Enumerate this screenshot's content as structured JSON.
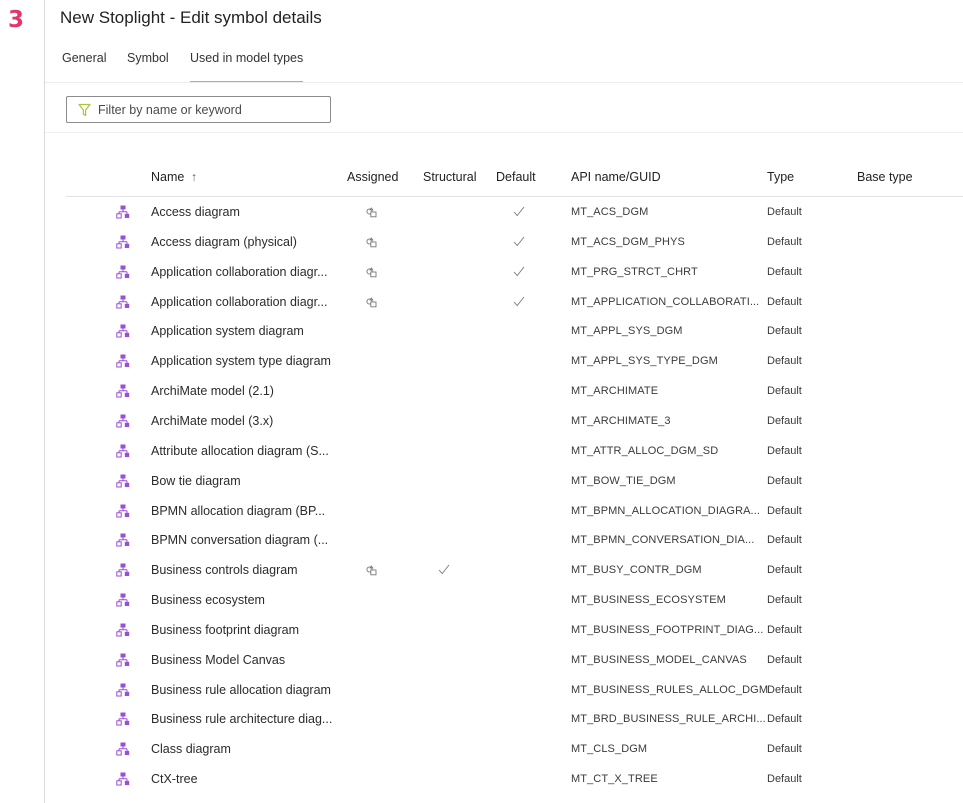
{
  "step_number": "3",
  "title": "New Stoplight - Edit symbol details",
  "tabs": [
    {
      "label": "General",
      "active": false
    },
    {
      "label": "Symbol",
      "active": false
    },
    {
      "label": "Used in model types",
      "active": true
    }
  ],
  "filter": {
    "placeholder": "Filter by name or keyword",
    "value": "",
    "icon": "filter-funnel-icon"
  },
  "accent_color": "#a9c43f",
  "step_color": "#e2356b",
  "model_icon_color": "#9b4fd6",
  "table": {
    "columns": {
      "name": "Name",
      "name_sort": "↑",
      "assigned": "Assigned",
      "structural": "Structural",
      "default": "Default",
      "api": "API name/GUID",
      "type": "Type",
      "base_type": "Base type"
    },
    "rows": [
      {
        "name": "Access diagram",
        "assigned": true,
        "structural": false,
        "default": true,
        "api": "MT_ACS_DGM",
        "type": "Default",
        "base_type": ""
      },
      {
        "name": "Access diagram (physical)",
        "assigned": true,
        "structural": false,
        "default": true,
        "api": "MT_ACS_DGM_PHYS",
        "type": "Default",
        "base_type": ""
      },
      {
        "name": "Application collaboration diagr...",
        "assigned": true,
        "structural": false,
        "default": true,
        "api": "MT_PRG_STRCT_CHRT",
        "type": "Default",
        "base_type": ""
      },
      {
        "name": "Application collaboration diagr...",
        "assigned": true,
        "structural": false,
        "default": true,
        "api": "MT_APPLICATION_COLLABORATI...",
        "type": "Default",
        "base_type": ""
      },
      {
        "name": "Application system diagram",
        "assigned": false,
        "structural": false,
        "default": false,
        "api": "MT_APPL_SYS_DGM",
        "type": "Default",
        "base_type": ""
      },
      {
        "name": "Application system type diagram",
        "assigned": false,
        "structural": false,
        "default": false,
        "api": "MT_APPL_SYS_TYPE_DGM",
        "type": "Default",
        "base_type": ""
      },
      {
        "name": "ArchiMate model (2.1)",
        "assigned": false,
        "structural": false,
        "default": false,
        "api": "MT_ARCHIMATE",
        "type": "Default",
        "base_type": ""
      },
      {
        "name": "ArchiMate model (3.x)",
        "assigned": false,
        "structural": false,
        "default": false,
        "api": "MT_ARCHIMATE_3",
        "type": "Default",
        "base_type": ""
      },
      {
        "name": "Attribute allocation diagram (S...",
        "assigned": false,
        "structural": false,
        "default": false,
        "api": "MT_ATTR_ALLOC_DGM_SD",
        "type": "Default",
        "base_type": ""
      },
      {
        "name": "Bow tie diagram",
        "assigned": false,
        "structural": false,
        "default": false,
        "api": "MT_BOW_TIE_DGM",
        "type": "Default",
        "base_type": ""
      },
      {
        "name": "BPMN allocation diagram (BP...",
        "assigned": false,
        "structural": false,
        "default": false,
        "api": "MT_BPMN_ALLOCATION_DIAGRA...",
        "type": "Default",
        "base_type": ""
      },
      {
        "name": "BPMN conversation diagram (...",
        "assigned": false,
        "structural": false,
        "default": false,
        "api": "MT_BPMN_CONVERSATION_DIA...",
        "type": "Default",
        "base_type": ""
      },
      {
        "name": "Business controls diagram",
        "assigned": true,
        "structural": true,
        "default": false,
        "api": "MT_BUSY_CONTR_DGM",
        "type": "Default",
        "base_type": ""
      },
      {
        "name": "Business ecosystem",
        "assigned": false,
        "structural": false,
        "default": false,
        "api": "MT_BUSINESS_ECOSYSTEM",
        "type": "Default",
        "base_type": ""
      },
      {
        "name": "Business footprint diagram",
        "assigned": false,
        "structural": false,
        "default": false,
        "api": "MT_BUSINESS_FOOTPRINT_DIAG...",
        "type": "Default",
        "base_type": ""
      },
      {
        "name": "Business Model Canvas",
        "assigned": false,
        "structural": false,
        "default": false,
        "api": "MT_BUSINESS_MODEL_CANVAS",
        "type": "Default",
        "base_type": ""
      },
      {
        "name": "Business rule allocation diagram",
        "assigned": false,
        "structural": false,
        "default": false,
        "api": "MT_BUSINESS_RULES_ALLOC_DGM",
        "type": "Default",
        "base_type": ""
      },
      {
        "name": "Business rule architecture diag...",
        "assigned": false,
        "structural": false,
        "default": false,
        "api": "MT_BRD_BUSINESS_RULE_ARCHI...",
        "type": "Default",
        "base_type": ""
      },
      {
        "name": "Class diagram",
        "assigned": false,
        "structural": false,
        "default": false,
        "api": "MT_CLS_DGM",
        "type": "Default",
        "base_type": ""
      },
      {
        "name": "CtX-tree",
        "assigned": false,
        "structural": false,
        "default": false,
        "api": "MT_CT_X_TREE",
        "type": "Default",
        "base_type": ""
      }
    ]
  }
}
